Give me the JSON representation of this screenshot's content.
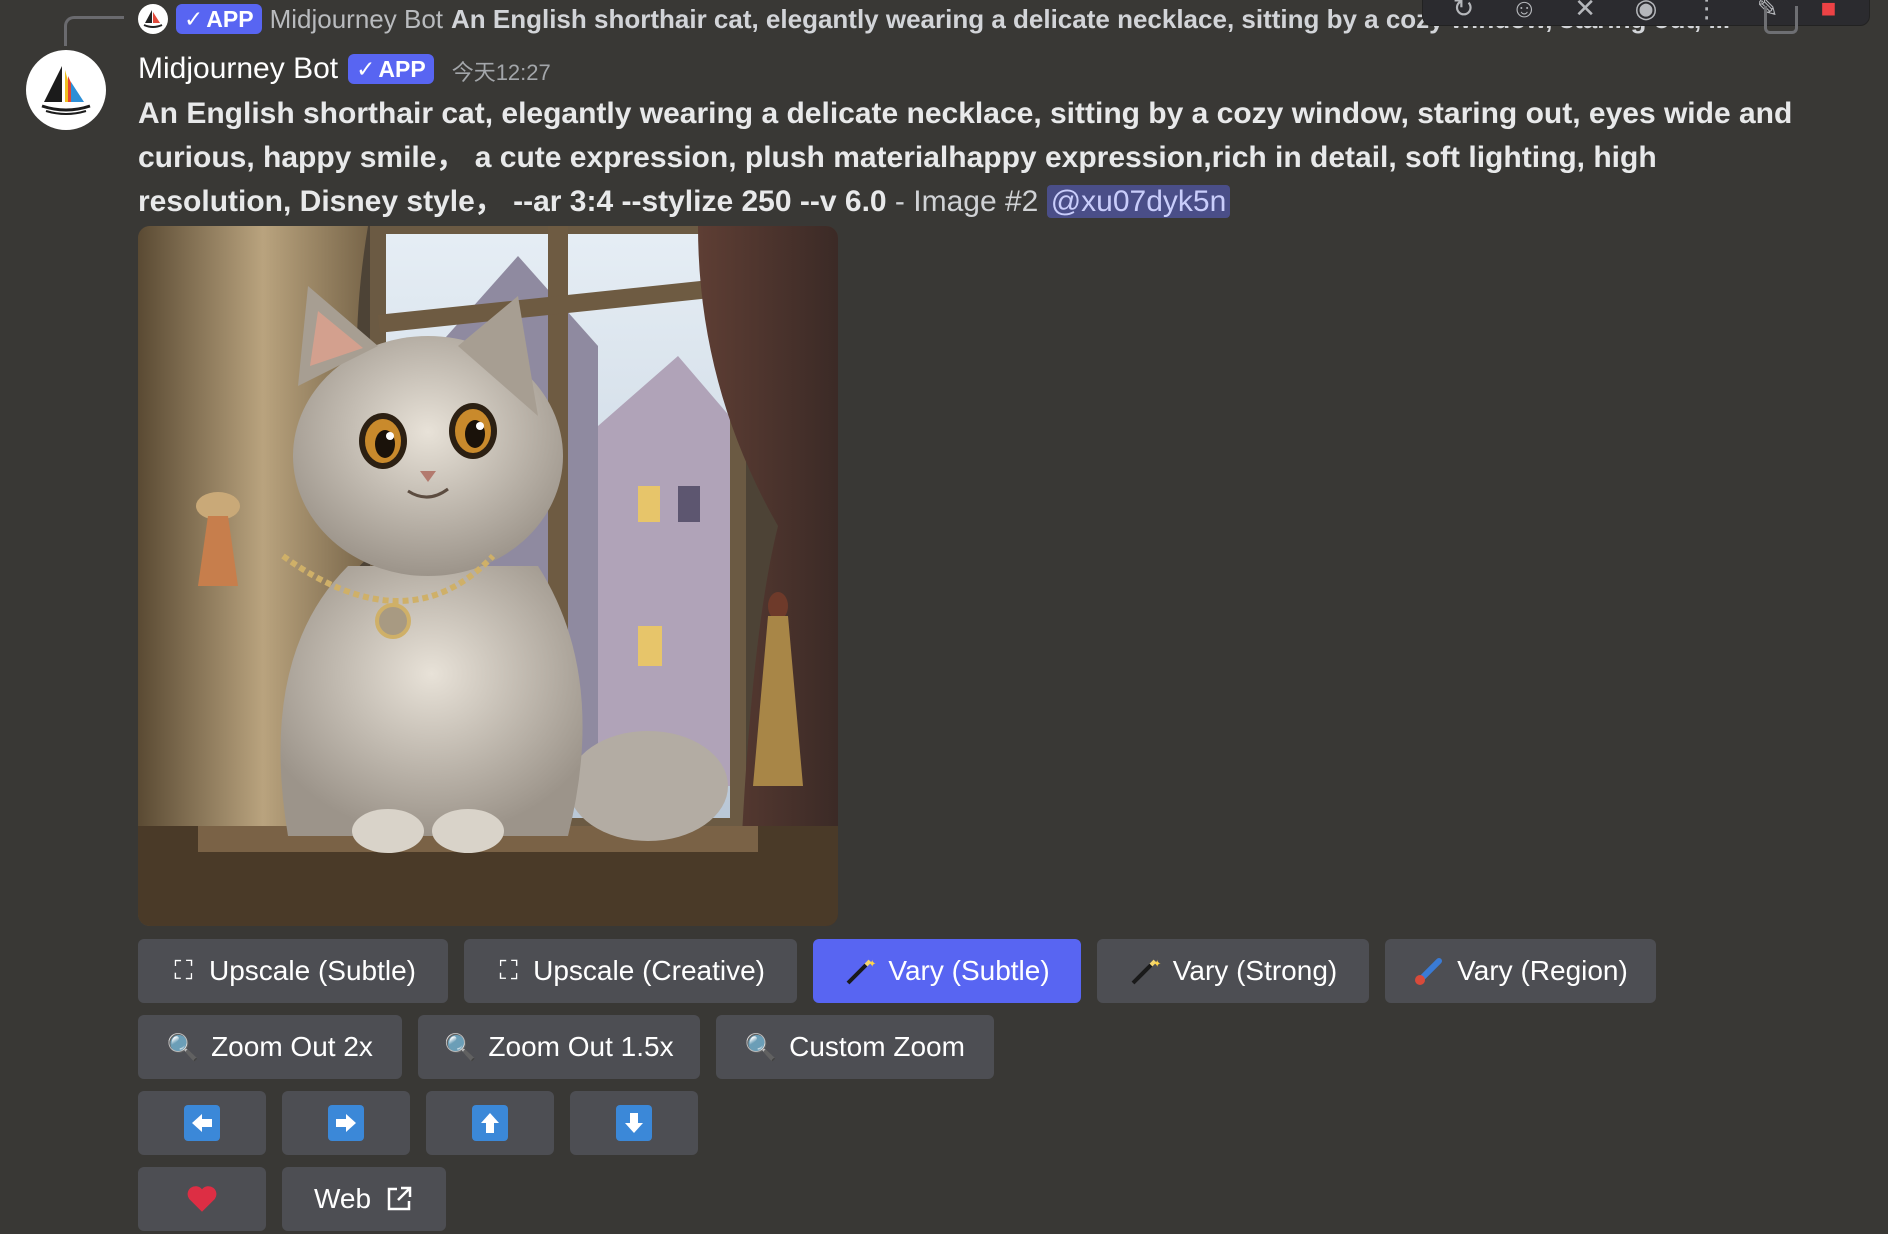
{
  "reply": {
    "author": "Midjourney Bot",
    "app_badge": "APP",
    "text": "An English shorthair cat, elegantly wearing a delicate necklace, sitting by a cozy window, staring out, ..."
  },
  "toolbar": {
    "icons": [
      "reaction-icon",
      "add-reaction-icon",
      "tools-icon",
      "thread-icon",
      "more-icon",
      "pin-icon",
      "delete-icon"
    ]
  },
  "message": {
    "author": "Midjourney Bot",
    "app_badge": "APP",
    "timestamp": "今天12:27",
    "prompt": "An English shorthair cat, elegantly wearing a delicate necklace, sitting by a cozy window, staring out, eyes wide and curious, happy smile，  a cute expression, plush materialhappy expression,rich in detail, soft lighting, high resolution, Disney style，  --ar 3:4 --stylize 250 --v 6.0",
    "separator": " - ",
    "image_label": "Image #2",
    "mention": "@xu07dyk5n"
  },
  "buttons": {
    "upscale_subtle": "Upscale (Subtle)",
    "upscale_creative": "Upscale (Creative)",
    "vary_subtle": "Vary (Subtle)",
    "vary_strong": "Vary (Strong)",
    "vary_region": "Vary (Region)",
    "zoom_out_2x": "Zoom Out 2x",
    "zoom_out_15x": "Zoom Out 1.5x",
    "custom_zoom": "Custom Zoom",
    "web": "Web"
  },
  "colors": {
    "background": "#393835",
    "button": "#4d4e53",
    "primary": "#5865f2",
    "mention_bg": "#4a4e88",
    "arrow": "#3b88d8",
    "heart": "#dd2e44"
  }
}
